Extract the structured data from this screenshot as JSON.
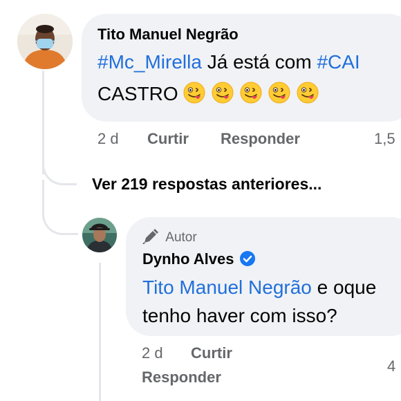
{
  "comment": {
    "author": "Tito Manuel Negrão",
    "text_line1": {
      "mention": "#Mc_Mirella",
      "middle": " Já está com ",
      "tag": "#CAI"
    },
    "text_line2": "CASTRO",
    "emojis": [
      "winking-face-with-tongue",
      "winking-face-with-tongue",
      "winking-face-with-tongue",
      "winking-face-with-tongue",
      "winking-face-with-tongue"
    ],
    "time": "2 d",
    "like_label": "Curtir",
    "reply_label": "Responder",
    "count": "1,5"
  },
  "view_previous": "Ver 219 respostas anteriores...",
  "reply": {
    "badge": "Autor",
    "author": "Dynho Alves",
    "mention": "Tito Manuel Negrão",
    "text_after_mention": " e oque",
    "text_line2": "tenho haver com isso?",
    "time": "2 d",
    "like_label": "Curtir",
    "reply_label": "Responder",
    "count": "4"
  },
  "colors": {
    "link": "#216fdb",
    "verified": "#1877f2",
    "bubble": "#f0f2f5",
    "meta": "#65676b",
    "thread_line": "#e4e6eb"
  }
}
